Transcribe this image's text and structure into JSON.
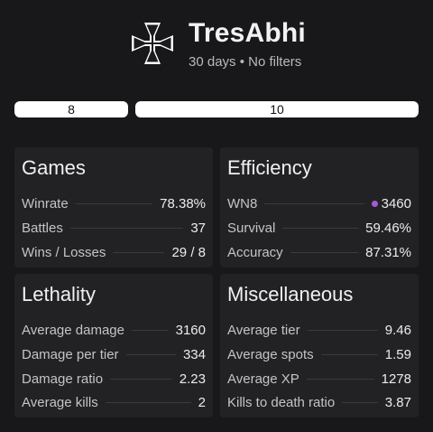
{
  "header": {
    "player_name": "TresAbhi",
    "subtitle": "30 days • No filters",
    "emblem_icon": "iron-cross-icon"
  },
  "selectors": {
    "left_value": "8",
    "right_value": "10"
  },
  "cards": {
    "games": {
      "title": "Games",
      "rows": [
        {
          "label": "Winrate",
          "value": "78.38%"
        },
        {
          "label": "Battles",
          "value": "37"
        },
        {
          "label": "Wins / Losses",
          "value": "29 / 8"
        }
      ]
    },
    "efficiency": {
      "title": "Efficiency",
      "rows": [
        {
          "label": "WN8",
          "value": "3460",
          "dot_color": "#a15cd8"
        },
        {
          "label": "Survival",
          "value": "59.46%"
        },
        {
          "label": "Accuracy",
          "value": "87.31%"
        }
      ]
    },
    "lethality": {
      "title": "Lethality",
      "rows": [
        {
          "label": "Average damage",
          "value": "3160"
        },
        {
          "label": "Damage per tier",
          "value": "334"
        },
        {
          "label": "Damage ratio",
          "value": "2.23"
        },
        {
          "label": "Average kills",
          "value": "2"
        }
      ]
    },
    "miscellaneous": {
      "title": "Miscellaneous",
      "rows": [
        {
          "label": "Average tier",
          "value": "9.46"
        },
        {
          "label": "Average spots",
          "value": "1.59"
        },
        {
          "label": "Average XP",
          "value": "1278"
        },
        {
          "label": "Kills to death ratio",
          "value": "3.87"
        }
      ]
    }
  },
  "colors": {
    "background": "#18181b",
    "card": "#222225",
    "wn8_dot": "#a15cd8"
  }
}
